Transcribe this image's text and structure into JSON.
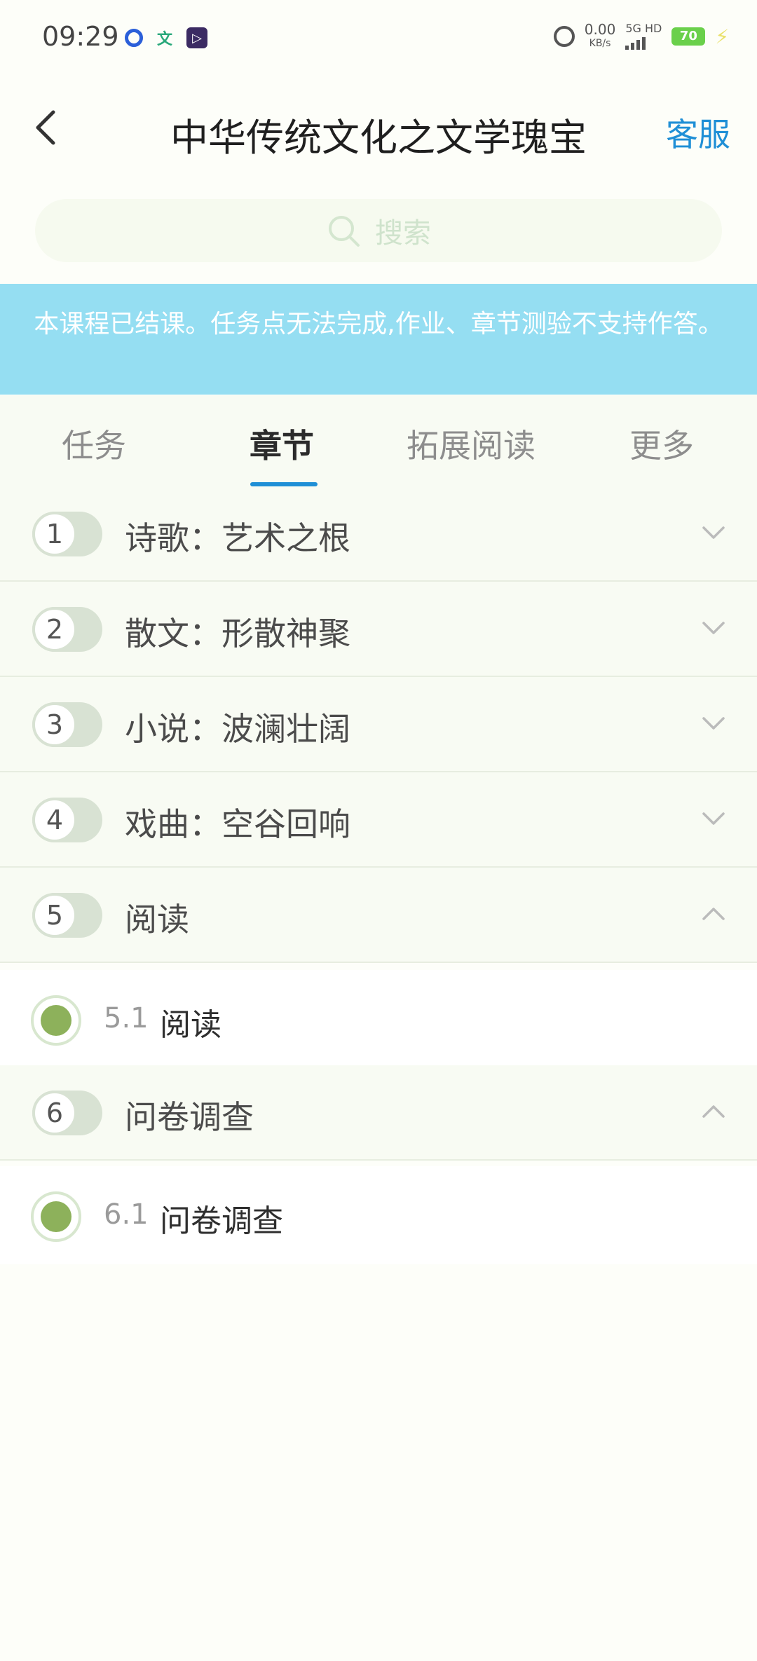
{
  "status": {
    "time": "09:29",
    "speed_value": "0.00",
    "speed_unit": "KB/s",
    "network": "5G HD",
    "battery": "70"
  },
  "header": {
    "title": "中华传统文化之文学瑰宝",
    "service_label": "客服"
  },
  "search": {
    "placeholder": "搜索"
  },
  "banner": {
    "text": "本课程已结课。任务点无法完成,作业、章节测验不支持作答。"
  },
  "tabs": [
    {
      "label": "任务"
    },
    {
      "label": "章节"
    },
    {
      "label": "拓展阅读"
    },
    {
      "label": "更多"
    }
  ],
  "chapters": [
    {
      "number": "1",
      "title": "诗歌：艺术之根"
    },
    {
      "number": "2",
      "title": "散文：形散神聚"
    },
    {
      "number": "3",
      "title": "小说：波澜壮阔"
    },
    {
      "number": "4",
      "title": "戏曲：空谷回响"
    },
    {
      "number": "5",
      "title": "阅读",
      "sub": {
        "number": "5.1",
        "title": "阅读"
      }
    },
    {
      "number": "6",
      "title": "问卷调查",
      "sub": {
        "number": "6.1",
        "title": "问卷调查"
      }
    }
  ],
  "colors": {
    "accent": "#1f8fd6",
    "banner_bg": "#95def2",
    "task_done": "#8db15b"
  }
}
